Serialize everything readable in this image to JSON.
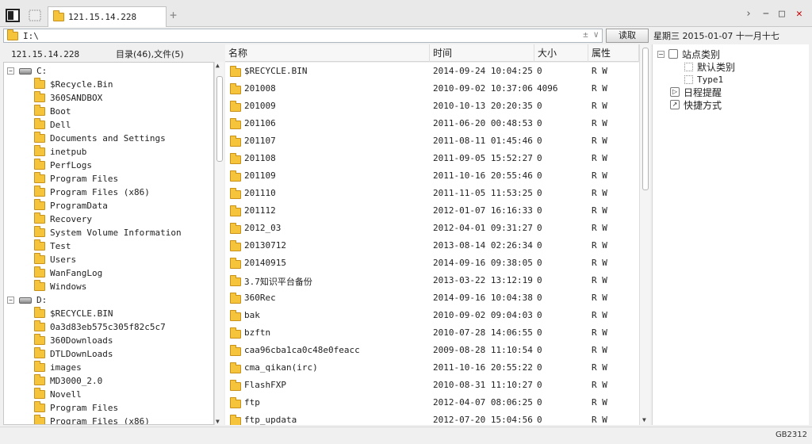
{
  "tab": {
    "title": "121.15.14.228",
    "add_symbol": "+"
  },
  "window_controls": {
    "forward": "›",
    "minimize": "−",
    "maximize": "□",
    "close": "✕"
  },
  "address": {
    "path": "I:\\",
    "arrows": "±  ∨"
  },
  "read_button": {
    "label": "读取"
  },
  "date": "星期三  2015-01-07  十一月十七",
  "left_header": {
    "host": "121.15.14.228",
    "summary": "目录(46),文件(5)"
  },
  "tree": {
    "drive_c": {
      "label": "C:",
      "toggle": "−"
    },
    "c_items": [
      "$Recycle.Bin",
      "360SANDBOX",
      "Boot",
      "Dell",
      "Documents and Settings",
      "inetpub",
      "PerfLogs",
      "Program Files",
      "Program Files (x86)",
      "ProgramData",
      "Recovery",
      "System Volume Information",
      "Test",
      "Users",
      "WanFangLog",
      "Windows"
    ],
    "drive_d": {
      "label": "D:",
      "toggle": "−"
    },
    "d_items": [
      "$RECYCLE.BIN",
      "0a3d83eb575c305f82c5c7",
      "360Downloads",
      "DTLDownLoads",
      "images",
      "MD3000_2.0",
      "Novell",
      "Program Files",
      "Program Files (x86)"
    ]
  },
  "columns": {
    "name": "名称",
    "time": "时间",
    "size": "大小",
    "attr": "属性"
  },
  "files": [
    {
      "name": "$RECYCLE.BIN",
      "time": "2014-09-24 10:04:25",
      "size": "0",
      "attr": "R W"
    },
    {
      "name": "201008",
      "time": "2010-09-02 10:37:06",
      "size": "4096",
      "attr": "R W"
    },
    {
      "name": "201009",
      "time": "2010-10-13 20:20:35",
      "size": "0",
      "attr": "R W"
    },
    {
      "name": "201106",
      "time": "2011-06-20 00:48:53",
      "size": "0",
      "attr": "R W"
    },
    {
      "name": "201107",
      "time": "2011-08-11 01:45:46",
      "size": "0",
      "attr": "R W"
    },
    {
      "name": "201108",
      "time": "2011-09-05 15:52:27",
      "size": "0",
      "attr": "R W"
    },
    {
      "name": "201109",
      "time": "2011-10-16 20:55:46",
      "size": "0",
      "attr": "R W"
    },
    {
      "name": "201110",
      "time": "2011-11-05 11:53:25",
      "size": "0",
      "attr": "R W"
    },
    {
      "name": "201112",
      "time": "2012-01-07 16:16:33",
      "size": "0",
      "attr": "R W"
    },
    {
      "name": "2012_03",
      "time": "2012-04-01 09:31:27",
      "size": "0",
      "attr": "R W"
    },
    {
      "name": "20130712",
      "time": "2013-08-14 02:26:34",
      "size": "0",
      "attr": "R W"
    },
    {
      "name": "20140915",
      "time": "2014-09-16 09:38:05",
      "size": "0",
      "attr": "R W"
    },
    {
      "name": "3.7知识平台备份",
      "time": "2013-03-22 13:12:19",
      "size": "0",
      "attr": "R W"
    },
    {
      "name": "360Rec",
      "time": "2014-09-16 10:04:38",
      "size": "0",
      "attr": "R W"
    },
    {
      "name": "bak",
      "time": "2010-09-02 09:04:03",
      "size": "0",
      "attr": "R W"
    },
    {
      "name": "bzftn",
      "time": "2010-07-28 14:06:55",
      "size": "0",
      "attr": "R W"
    },
    {
      "name": "caa96cba1ca0c48e0feacc",
      "time": "2009-08-28 11:10:54",
      "size": "0",
      "attr": "R W"
    },
    {
      "name": "cma_qikan(irc)",
      "time": "2011-10-16 20:55:22",
      "size": "0",
      "attr": "R W"
    },
    {
      "name": "FlashFXP",
      "time": "2010-08-31 11:10:27",
      "size": "0",
      "attr": "R W"
    },
    {
      "name": "ftp",
      "time": "2012-04-07 08:06:25",
      "size": "0",
      "attr": "R W"
    },
    {
      "name": "ftp_updata",
      "time": "2012-07-20 15:04:56",
      "size": "0",
      "attr": "R W"
    }
  ],
  "right_panel": {
    "site_category": {
      "label": "站点类别",
      "toggle": "−"
    },
    "default_category": "默认类别",
    "type1": "Type1",
    "schedule": "日程提醒",
    "shortcut": "快捷方式"
  },
  "status": {
    "text": "GB2312"
  }
}
